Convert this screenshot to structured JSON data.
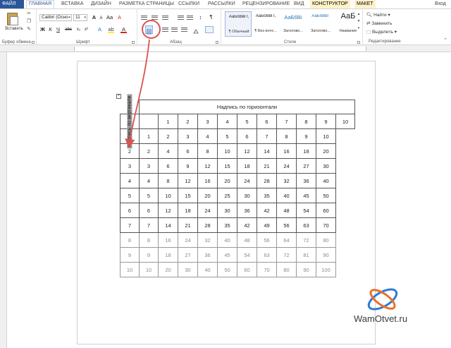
{
  "tabs": {
    "file": "ФАЙЛ",
    "home": "ГЛАВНАЯ",
    "insert": "ВСТАВКА",
    "design": "ДИЗАЙН",
    "layout": "РАЗМЕТКА СТРАНИЦЫ",
    "references": "ССЫЛКИ",
    "mailings": "РАССЫЛКИ",
    "review": "РЕЦЕНЗИРОВАНИЕ",
    "view": "ВИД",
    "constructor": "КОНСТРУКТОР",
    "table_layout": "МАКЕТ",
    "signin": "Вход"
  },
  "clipboard": {
    "paste_label": "Вставить",
    "group_label": "Буфер обмена"
  },
  "font": {
    "name": "Calibri (Осно",
    "size": "11",
    "group_label": "Шрифт",
    "bold": "Ж",
    "italic": "К",
    "underline": "Ч",
    "strike": "abc"
  },
  "paragraph": {
    "group_label": "Абзац"
  },
  "styles": {
    "group_label": "Стили",
    "items": [
      {
        "preview": "АаБбВвГг,",
        "name": "¶ Обычный"
      },
      {
        "preview": "АаБбВвГг,",
        "name": "¶ Без инте..."
      },
      {
        "preview": "АаБбВі",
        "name": "Заголово..."
      },
      {
        "preview": "АаБбВвГ",
        "name": "Заголово..."
      },
      {
        "preview": "АаБ",
        "name": "Название"
      }
    ]
  },
  "editing": {
    "find": "Найти",
    "replace": "Заменить",
    "select": "Выделить",
    "group_label": "Редактирование"
  },
  "table": {
    "horizontal_caption": "Надпись по горизонтали",
    "vertical_caption": "Надпись по вертикали",
    "header": [
      "1",
      "2",
      "3",
      "4",
      "5",
      "6",
      "7",
      "8",
      "9",
      "10"
    ],
    "rows": [
      [
        "1",
        "1",
        "2",
        "3",
        "4",
        "5",
        "6",
        "7",
        "8",
        "9",
        "10"
      ],
      [
        "2",
        "2",
        "4",
        "6",
        "8",
        "10",
        "12",
        "14",
        "16",
        "18",
        "20"
      ],
      [
        "3",
        "3",
        "6",
        "9",
        "12",
        "15",
        "18",
        "21",
        "24",
        "27",
        "30"
      ],
      [
        "4",
        "4",
        "8",
        "12",
        "16",
        "20",
        "24",
        "28",
        "32",
        "36",
        "40"
      ],
      [
        "5",
        "5",
        "10",
        "15",
        "20",
        "25",
        "30",
        "35",
        "40",
        "45",
        "50"
      ],
      [
        "6",
        "6",
        "12",
        "18",
        "24",
        "30",
        "36",
        "42",
        "48",
        "54",
        "60"
      ],
      [
        "7",
        "7",
        "14",
        "21",
        "28",
        "35",
        "42",
        "49",
        "56",
        "63",
        "70"
      ],
      [
        "8",
        "8",
        "16",
        "24",
        "32",
        "40",
        "48",
        "56",
        "64",
        "72",
        "80"
      ],
      [
        "9",
        "9",
        "18",
        "27",
        "36",
        "45",
        "54",
        "63",
        "72",
        "81",
        "90"
      ],
      [
        "10",
        "10",
        "20",
        "30",
        "40",
        "50",
        "60",
        "70",
        "80",
        "90",
        "100"
      ]
    ]
  },
  "watermark": {
    "text": "WamOtvet.ru"
  },
  "colors": {
    "file_tab": "#2b579a",
    "annotation": "#d9534f",
    "context_tab": "#fff2c9"
  },
  "icons": [
    "paste-icon",
    "cut-icon",
    "copy-icon",
    "format-painter-icon",
    "text-direction-icon",
    "bullets-icon",
    "numbering-icon",
    "pilcrow-icon",
    "find-icon",
    "replace-icon",
    "select-icon",
    "table-move-handle-icon"
  ]
}
